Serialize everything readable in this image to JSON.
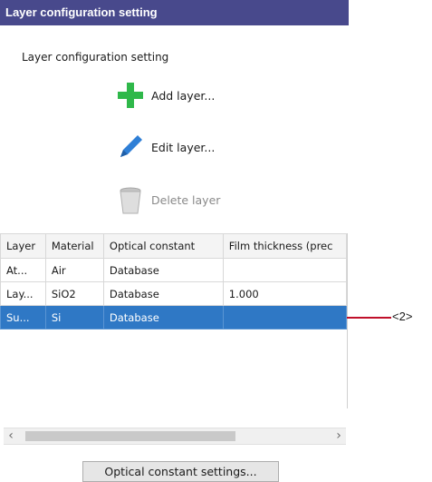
{
  "window": {
    "title": "Layer configuration setting"
  },
  "panel": {
    "label": "Layer configuration setting"
  },
  "actions": {
    "add_label": "Add layer...",
    "edit_label": "Edit layer...",
    "delete_label": "Delete layer"
  },
  "table": {
    "columns": [
      "Layer",
      "Material",
      "Optical constant",
      "Film thickness (prec"
    ],
    "rows": [
      {
        "layer": "At...",
        "material": "Air",
        "optical": "Database",
        "thickness": ""
      },
      {
        "layer": "Lay...",
        "material": "SiO2",
        "optical": "Database",
        "thickness": "1.000"
      },
      {
        "layer": "Su...",
        "material": "Si",
        "optical": "Database",
        "thickness": ""
      }
    ]
  },
  "callout": {
    "label": "<2>"
  },
  "scrollbar": {
    "left_arrow": "‹",
    "right_arrow": "›"
  },
  "footer": {
    "optical_button_label": "Optical constant settings..."
  },
  "colors": {
    "titlebar": "#48498c",
    "selection": "#2f78c5",
    "callout": "#c0102a",
    "add_icon": "#2fb84a",
    "edit_icon": "#2f7fd6"
  }
}
